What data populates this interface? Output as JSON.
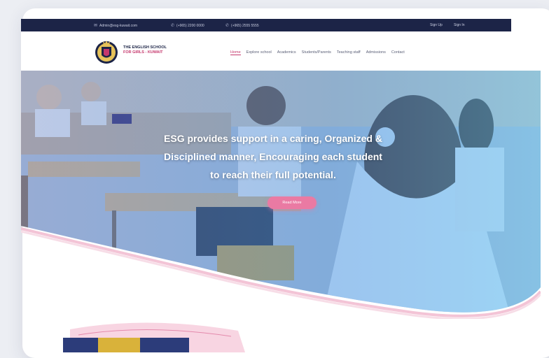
{
  "topbar": {
    "email": "Admin@esg-kuwait.com",
    "phone1": "(+965) 2200 0000",
    "phone2": "(+965) 2555 5555",
    "link1": "Sign Up",
    "link2": "Sign In"
  },
  "brand": {
    "line1": "THE ENGLISH SCHOOL",
    "line2": "FOR GIRLS - KUWAIT"
  },
  "nav": {
    "items": [
      "Home",
      "Explore school",
      "Academics",
      "Students/Parents",
      "Teaching staff",
      "Admissions",
      "Contact"
    ]
  },
  "hero": {
    "line1": "ESG provides support in a caring, Organized &",
    "line2": "Disciplined manner, Encouraging each student",
    "line3": "to reach their full potential.",
    "button": "Read More"
  },
  "colors": {
    "navy": "#1c2447",
    "accent": "#c5376c",
    "button": "#ea7aa3",
    "overlay": "#3f8fe0"
  }
}
